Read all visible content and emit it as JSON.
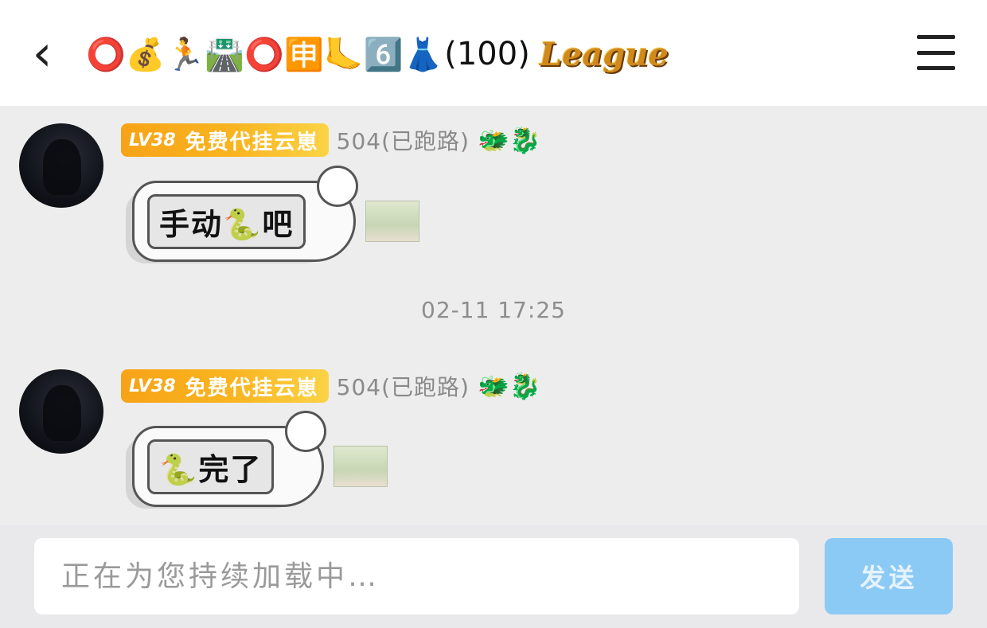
{
  "header": {
    "back_icon": "chevron-left-icon",
    "title_emoji": "⭕💰🏃🛣️⭕🈸🦶6️⃣👗",
    "title_count": "(100)",
    "title_logo": "League",
    "menu_icon": "hamburger-menu-icon"
  },
  "messages": [
    {
      "badge_level": "LV38",
      "badge_tag": "免费代挂云崽",
      "sender": "504(已跑路)",
      "deco": "🐲🐉",
      "sticker_text": "手动🐍吧"
    },
    {
      "badge_level": "LV38",
      "badge_tag": "免费代挂云崽",
      "sender": "504(已跑路)",
      "deco": "🐲🐉",
      "sticker_text": "🐍完了"
    }
  ],
  "timestamp": "02-11 17:25",
  "composer": {
    "placeholder": "正在为您持续加载中…",
    "send_label": "发送"
  },
  "colors": {
    "badge": "#f7a317",
    "send_button": "#8ccaf6",
    "background": "#ededed"
  }
}
